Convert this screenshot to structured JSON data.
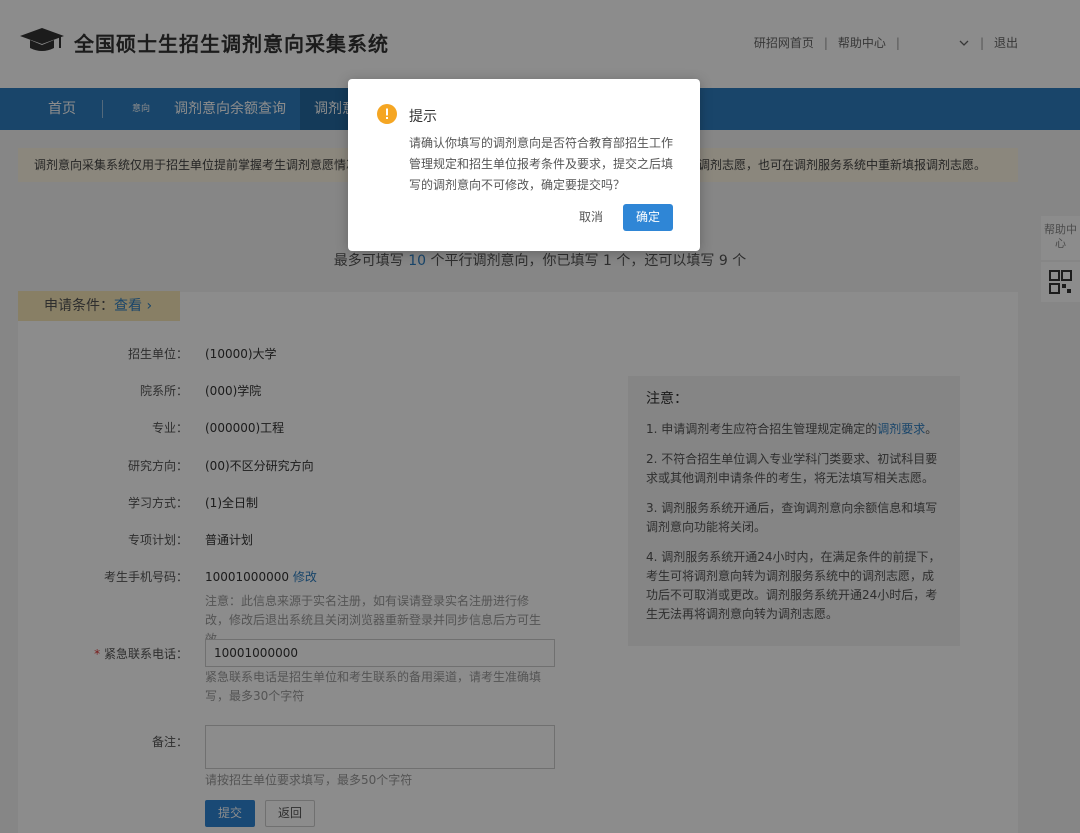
{
  "header": {
    "title": "全国硕士生招生调剂意向采集系统",
    "links": [
      "研招网首页",
      "帮助中心",
      "退出"
    ],
    "user_dropdown_caret": "chevron-down-icon"
  },
  "nav": {
    "home": "首页",
    "small_label": "意向",
    "quota_query": "调剂意向余额查询",
    "active_tab": "调剂意"
  },
  "notice": {
    "left": "调剂意向采集系统仅用于招生单位提前掌握考生调剂意愿情况",
    "right": "调剂志愿，也可在调剂服务系统中重新填报调剂志愿。"
  },
  "count_line": {
    "prefix": "最多可填写",
    "max": "10",
    "middle1": "个平行调剂意向，你已填写",
    "filled": "1",
    "middle2": "个，还可以填写",
    "remain": "9",
    "suffix": "个"
  },
  "conditions": {
    "label": "申请条件：",
    "link": "查看 ›"
  },
  "form": {
    "unit_label": "招生单位：",
    "unit_value": "(10000)大学",
    "dept_label": "院系所：",
    "dept_value": "(000)学院",
    "major_label": "专业：",
    "major_value": "(000000)工程",
    "direction_label": "研究方向：",
    "direction_value": "(00)不区分研究方向",
    "mode_label": "学习方式：",
    "mode_value": "(1)全日制",
    "plan_label": "专项计划：",
    "plan_value": "普通计划",
    "phone_label": "考生手机号码：",
    "phone_value": "10001000000",
    "phone_edit": "修改",
    "phone_hint": "注意：此信息来源于实名注册，如有误请登录实名注册进行修改，修改后退出系统且关闭浏览器重新登录并同步信息后方可生效",
    "emergency_required": "*",
    "emergency_label": "紧急联系电话：",
    "emergency_value": "10001000000",
    "emergency_hint": "紧急联系电话是招生单位和考生联系的备用渠道，请考生准确填写，最多30个字符",
    "remark_label": "备注：",
    "remark_hint": "请按招生单位要求填写，最多50个字符",
    "submit": "提交",
    "back": "返回"
  },
  "notes": {
    "title": "注意：",
    "item1_prefix": "1. 申请调剂考生应符合招生管理规定确定的",
    "item1_link": "调剂要求",
    "item1_suffix": "。",
    "item2": "2. 不符合招生单位调入专业学科门类要求、初试科目要求或其他调剂申请条件的考生，将无法填写相关志愿。",
    "item3": "3. 调剂服务系统开通后，查询调剂意向余额信息和填写调剂意向功能将关闭。",
    "item4": "4. 调剂服务系统开通24小时内，在满足条件的前提下，考生可将调剂意向转为调剂服务系统中的调剂志愿，成功后不可取消或更改。调剂服务系统开通24小时后，考生无法再将调剂意向转为调剂志愿。"
  },
  "float": {
    "help": "帮助中心",
    "qr": "qr-code-icon"
  },
  "modal": {
    "title": "提示",
    "body": "请确认你填写的调剂意向是否符合教育部招生工作管理规定和招生单位报考条件及要求，提交之后填写的调剂意向不可修改，确定要提交吗？",
    "cancel": "取消",
    "ok": "确定",
    "icon_color": "#f5a623"
  }
}
